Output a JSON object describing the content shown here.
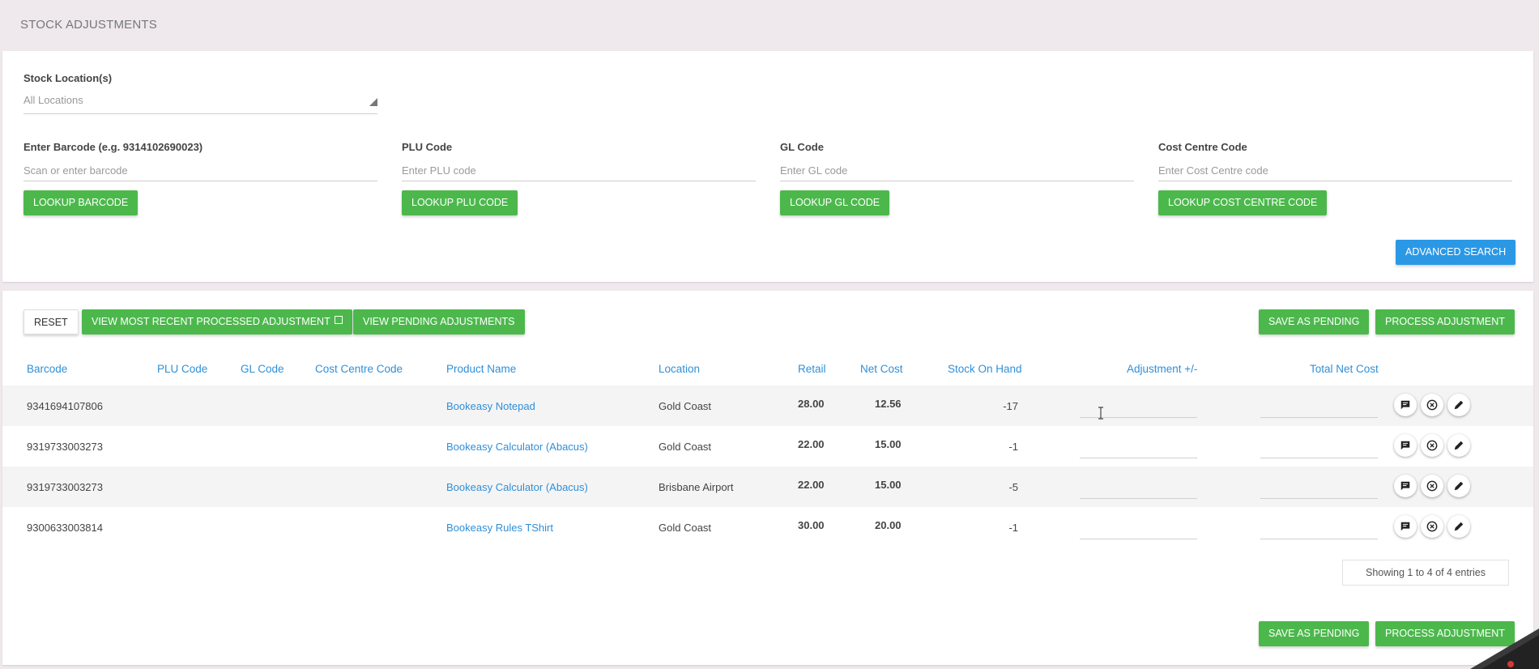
{
  "page": {
    "title": "STOCK ADJUSTMENTS"
  },
  "filters": {
    "stock_location_label": "Stock Location(s)",
    "stock_location_value": "All Locations",
    "barcode": {
      "label": "Enter Barcode (e.g. 9314102690023)",
      "placeholder": "Scan or enter barcode",
      "button": "LOOKUP BARCODE"
    },
    "plu": {
      "label": "PLU Code",
      "placeholder": "Enter PLU code",
      "button": "LOOKUP PLU CODE"
    },
    "gl": {
      "label": "GL Code",
      "placeholder": "Enter GL code",
      "button": "LOOKUP GL CODE"
    },
    "cost_centre": {
      "label": "Cost Centre Code",
      "placeholder": "Enter Cost Centre code",
      "button": "LOOKUP COST CENTRE CODE"
    },
    "advanced_search": "ADVANCED SEARCH"
  },
  "toolbar": {
    "reset": "RESET",
    "view_recent": "VIEW MOST RECENT PROCESSED ADJUSTMENT",
    "view_pending": "VIEW PENDING ADJUSTMENTS",
    "save_pending": "SAVE AS PENDING",
    "process": "PROCESS ADJUSTMENT"
  },
  "table": {
    "headers": {
      "barcode": "Barcode",
      "plu": "PLU Code",
      "gl": "GL Code",
      "cost_centre": "Cost Centre Code",
      "product": "Product Name",
      "location": "Location",
      "retail": "Retail",
      "net_cost": "Net Cost",
      "stock_on_hand": "Stock On Hand",
      "adjustment": "Adjustment +/-",
      "total_net_cost": "Total Net Cost"
    },
    "rows": [
      {
        "barcode": "9341694107806",
        "product": "Bookeasy Notepad",
        "location": "Gold Coast",
        "retail": "28.00",
        "net_cost": "12.56",
        "stock_on_hand": "-17"
      },
      {
        "barcode": "9319733003273",
        "product": "Bookeasy Calculator (Abacus)",
        "location": "Gold Coast",
        "retail": "22.00",
        "net_cost": "15.00",
        "stock_on_hand": "-1"
      },
      {
        "barcode": "9319733003273",
        "product": "Bookeasy Calculator (Abacus)",
        "location": "Brisbane Airport",
        "retail": "22.00",
        "net_cost": "15.00",
        "stock_on_hand": "-5"
      },
      {
        "barcode": "9300633003814",
        "product": "Bookeasy Rules TShirt",
        "location": "Gold Coast",
        "retail": "30.00",
        "net_cost": "20.00",
        "stock_on_hand": "-1"
      }
    ],
    "info": "Showing 1 to 4 of 4 entries"
  }
}
